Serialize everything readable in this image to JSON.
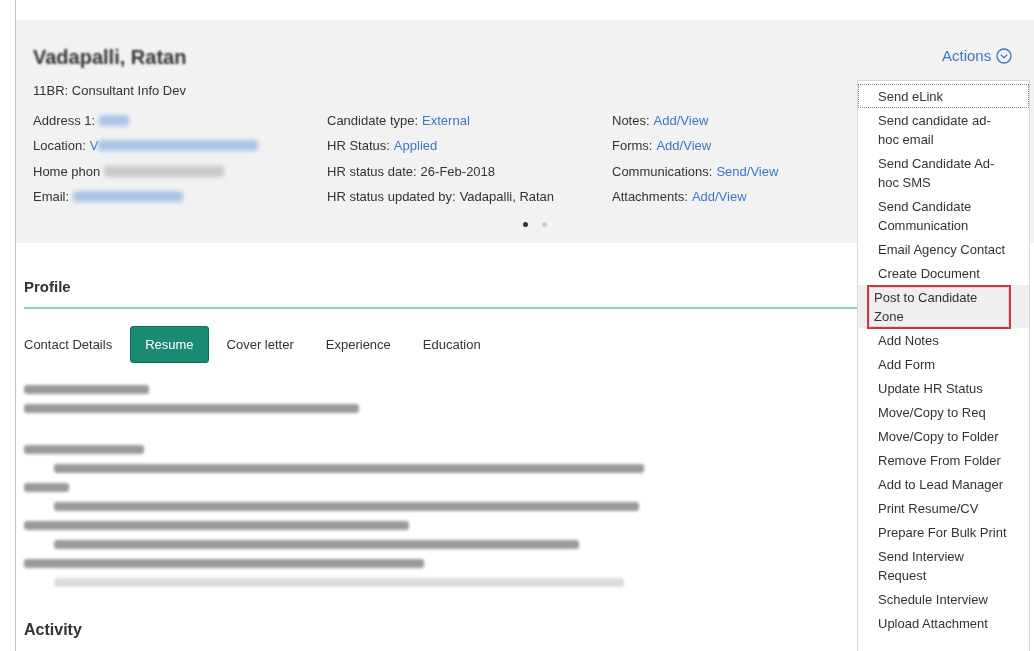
{
  "candidate": {
    "name": "Vadapalli, Ratan",
    "requisition": "11BR: Consultant Info Dev",
    "columns": [
      [
        {
          "label": "Address 1:",
          "kind": "link",
          "redacted": true
        },
        {
          "label": "Location:",
          "value": "V",
          "kind": "link",
          "redacted": true
        },
        {
          "label": "Home phon",
          "kind": "plain",
          "redacted": true
        },
        {
          "label": "Email:",
          "kind": "link",
          "redacted": true
        }
      ],
      [
        {
          "label": "Candidate type:",
          "value": "External",
          "kind": "link"
        },
        {
          "label": "HR Status:",
          "value": "Applied",
          "kind": "link"
        },
        {
          "label": "HR status date:",
          "value": "26-Feb-2018",
          "kind": "plain"
        },
        {
          "label": "HR status updated by:",
          "value": "Vadapalli, Ratan",
          "kind": "plain"
        }
      ],
      [
        {
          "label": "Notes:",
          "value": "Add/View",
          "kind": "link"
        },
        {
          "label": "Forms:",
          "value": "Add/View",
          "kind": "link"
        },
        {
          "label": "Communications:",
          "value": "Send/View",
          "kind": "link"
        },
        {
          "label": "Attachments:",
          "value": "Add/View",
          "kind": "link"
        }
      ]
    ],
    "carousel_dots": [
      {
        "selected": true
      },
      {
        "selected": false
      }
    ]
  },
  "actions": {
    "label": "Actions",
    "items": [
      {
        "label": "Send eLink",
        "focused": true,
        "highlighted": false
      },
      {
        "label": "Send candidate ad-hoc email",
        "focused": false,
        "highlighted": false
      },
      {
        "label": "Send Candidate Ad-hoc SMS",
        "focused": false,
        "highlighted": false
      },
      {
        "label": "Send Candidate Communication",
        "focused": false,
        "highlighted": false
      },
      {
        "label": "Email Agency Contact",
        "focused": false,
        "highlighted": false
      },
      {
        "label": "Create Document",
        "focused": false,
        "highlighted": false
      },
      {
        "label": "Post to Candidate Zone",
        "focused": false,
        "highlighted": true
      },
      {
        "label": "Add Notes",
        "focused": false,
        "highlighted": false
      },
      {
        "label": "Add Form",
        "focused": false,
        "highlighted": false
      },
      {
        "label": "Update HR Status",
        "focused": false,
        "highlighted": false
      },
      {
        "label": "Move/Copy to Req",
        "focused": false,
        "highlighted": false
      },
      {
        "label": "Move/Copy to Folder",
        "focused": false,
        "highlighted": false
      },
      {
        "label": "Remove From Folder",
        "focused": false,
        "highlighted": false
      },
      {
        "label": "Add to Lead Manager",
        "focused": false,
        "highlighted": false
      },
      {
        "label": "Print Resume/CV",
        "focused": false,
        "highlighted": false
      },
      {
        "label": "Prepare For Bulk Print",
        "focused": false,
        "highlighted": false
      },
      {
        "label": "Send Interview Request",
        "focused": false,
        "highlighted": false
      },
      {
        "label": "Schedule Interview",
        "focused": false,
        "highlighted": false
      },
      {
        "label": "Upload Attachment",
        "focused": false,
        "highlighted": false
      }
    ]
  },
  "profile": {
    "title": "Profile",
    "tabs": [
      {
        "label": "Contact Details",
        "selected": false
      },
      {
        "label": "Resume",
        "selected": true
      },
      {
        "label": "Cover letter",
        "selected": false
      },
      {
        "label": "Experience",
        "selected": false
      },
      {
        "label": "Education",
        "selected": false
      }
    ]
  },
  "activity": {
    "title": "Activity"
  }
}
